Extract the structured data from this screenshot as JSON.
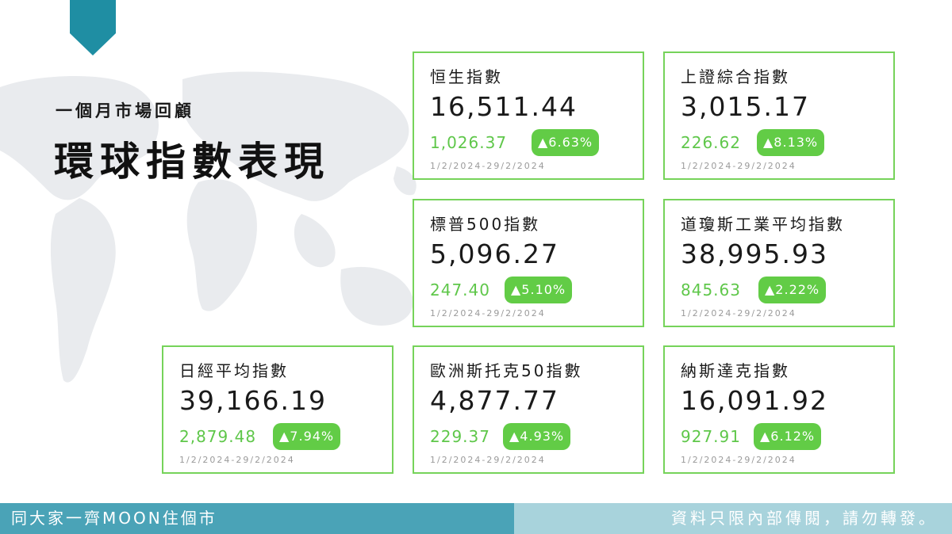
{
  "header": {
    "subtitle": "一個月市場回顧",
    "title": "環球指數表現"
  },
  "cards": [
    {
      "name": "恒生指數",
      "value": "16,511.44",
      "change": "1,026.37",
      "badge": "▲6.63%",
      "date": "1/2/2024-29/2/2024"
    },
    {
      "name": "上證綜合指數",
      "value": "3,015.17",
      "change": "226.62",
      "badge": "▲8.13%",
      "date": "1/2/2024-29/2/2024"
    },
    {
      "name": "標普500指數",
      "value": "5,096.27",
      "change": "247.40",
      "badge": "▲5.10%",
      "date": "1/2/2024-29/2/2024"
    },
    {
      "name": "道瓊斯工業平均指數",
      "value": "38,995.93",
      "change": "845.63",
      "badge": "▲2.22%",
      "date": "1/2/2024-29/2/2024"
    },
    {
      "name": "日經平均指數",
      "value": "39,166.19",
      "change": "2,879.48",
      "badge": "▲7.94%",
      "date": "1/2/2024-29/2/2024"
    },
    {
      "name": "歐洲斯托克50指數",
      "value": "4,877.77",
      "change": "229.37",
      "badge": "▲4.93%",
      "date": "1/2/2024-29/2/2024"
    },
    {
      "name": "納斯達克指數",
      "value": "16,091.92",
      "change": "927.91",
      "badge": "▲6.12%",
      "date": "1/2/2024-29/2/2024"
    }
  ],
  "footer": {
    "left": "同大家一齊MOON住個市",
    "right": "資料只限內部傳閱，請勿轉發。"
  },
  "colors": {
    "accent": "#1f8ea3",
    "card_border": "#76d35a",
    "positive": "#5fc74a",
    "badge_bg": "#62cc46",
    "footer_left": "#4aa3b7",
    "footer_right": "#a8d3dc"
  }
}
